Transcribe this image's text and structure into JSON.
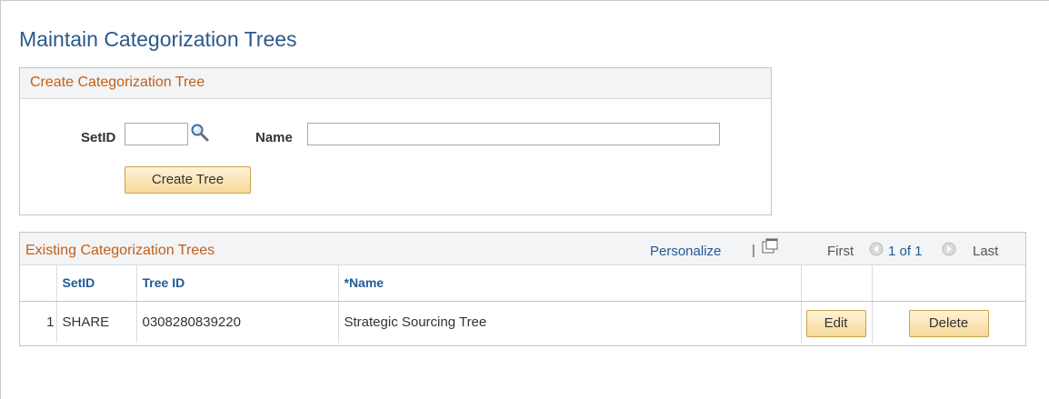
{
  "page": {
    "title": "Maintain Categorization Trees"
  },
  "create_section": {
    "title": "Create Categorization Tree",
    "setid_label": "SetID",
    "setid_value": "",
    "name_label": "Name",
    "name_value": "",
    "create_button": "Create Tree"
  },
  "grid": {
    "title": "Existing Categorization Trees",
    "personalize": "Personalize",
    "separator": "|",
    "nav_first": "First",
    "nav_count": "1 of 1",
    "nav_last": "Last",
    "columns": [
      "SetID",
      "Tree ID",
      "*Name",
      "",
      ""
    ],
    "rows": [
      {
        "num": "1",
        "setid": "SHARE",
        "tree_id": "0308280839220",
        "name": "Strategic Sourcing Tree",
        "edit": "Edit",
        "delete": "Delete"
      }
    ]
  },
  "colors": {
    "title": "#2a5a8a",
    "section_title": "#c0601a",
    "link": "#1f5a95",
    "button": "#f6d99a"
  },
  "icons": {
    "lookup": "magnifier-icon",
    "popup": "new-window-icon",
    "prev": "arrow-left-icon",
    "next": "arrow-right-icon"
  }
}
